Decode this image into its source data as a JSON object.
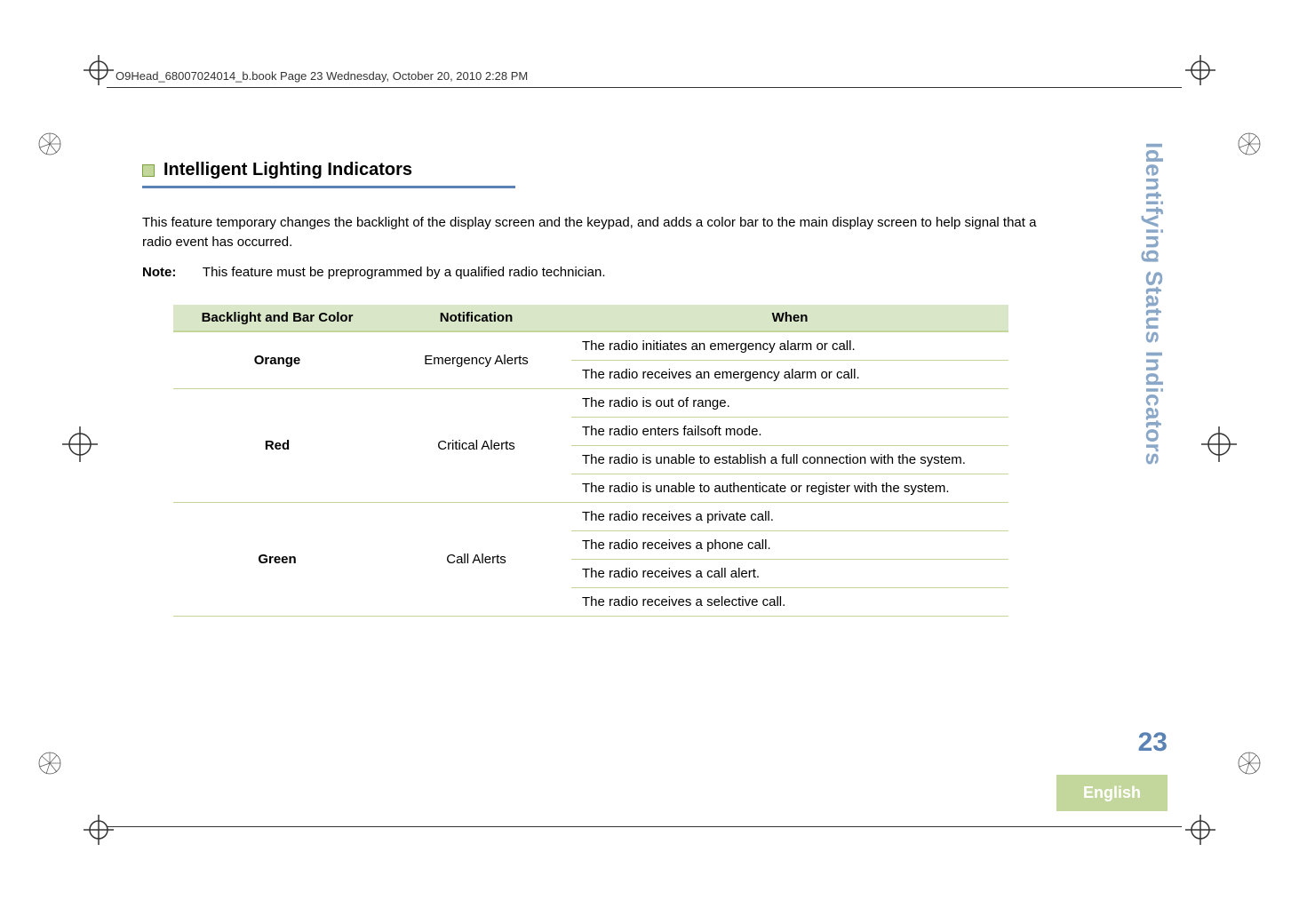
{
  "header": {
    "filename_line": "O9Head_68007024014_b.book  Page 23  Wednesday, October 20, 2010  2:28 PM"
  },
  "section": {
    "title": "Intelligent Lighting Indicators",
    "intro": "This feature temporary changes the backlight of the display screen and the keypad, and adds a color bar to the main display screen to help signal that a radio event has occurred.",
    "note_label": "Note:",
    "note_text": "This feature must be preprogrammed by a qualified radio technician."
  },
  "table": {
    "headers": {
      "col1": "Backlight and Bar Color",
      "col2": "Notification",
      "col3": "When"
    },
    "groups": [
      {
        "color": "Orange",
        "notification": "Emergency Alerts",
        "whens": [
          "The radio initiates an emergency alarm or call.",
          "The radio receives an emergency alarm or call."
        ]
      },
      {
        "color": "Red",
        "notification": "Critical Alerts",
        "whens": [
          "The radio is out of range.",
          "The radio enters failsoft mode.",
          "The radio is unable to establish a full connection with the system.",
          "The radio is unable to authenticate or register with the system."
        ]
      },
      {
        "color": "Green",
        "notification": "Call Alerts",
        "whens": [
          "The radio receives a private call.",
          "The radio receives a phone call.",
          "The radio receives a call alert.",
          "The radio receives a selective call."
        ]
      }
    ]
  },
  "side": {
    "tab": "Identifying Status Indicators",
    "page": "23",
    "language": "English"
  }
}
